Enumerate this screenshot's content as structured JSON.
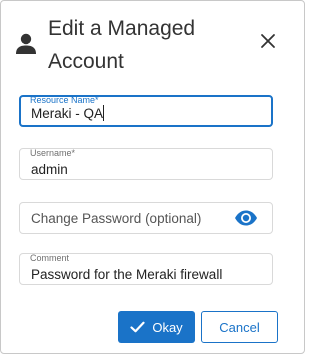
{
  "dialog": {
    "title_line1": "Edit a Managed",
    "title_line2": "Account",
    "icons": {
      "header": "user-icon",
      "close": "close-icon",
      "password_toggle": "eye-icon",
      "ok": "checkmark-icon"
    }
  },
  "form": {
    "resource_name": {
      "label": "Resource Name*",
      "value": "Meraki - QA"
    },
    "username": {
      "label": "Username*",
      "value": "admin"
    },
    "password": {
      "placeholder": "Change Password (optional)"
    },
    "comment": {
      "label": "Comment",
      "value": "Password for the Meraki firewall"
    }
  },
  "buttons": {
    "ok_label": "Okay",
    "cancel_label": "Cancel"
  },
  "colors": {
    "accent": "#1a73c8",
    "border": "#d9d9d9",
    "text": "#333333"
  }
}
